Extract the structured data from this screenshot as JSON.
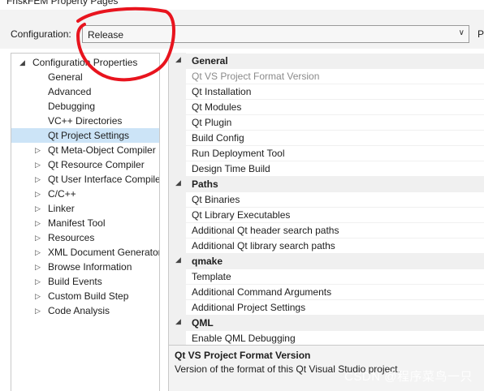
{
  "window": {
    "title": "FriskFEM Property Pages"
  },
  "config": {
    "label": "Configuration:",
    "value": "Release",
    "platform_label_partial": "P"
  },
  "tree": [
    {
      "label": "Configuration Properties",
      "level": 0,
      "expanded": true,
      "has_children": true,
      "selected": false
    },
    {
      "label": "General",
      "level": 1,
      "has_children": false,
      "selected": false
    },
    {
      "label": "Advanced",
      "level": 1,
      "has_children": false,
      "selected": false
    },
    {
      "label": "Debugging",
      "level": 1,
      "has_children": false,
      "selected": false
    },
    {
      "label": "VC++ Directories",
      "level": 1,
      "has_children": false,
      "selected": false
    },
    {
      "label": "Qt Project Settings",
      "level": 1,
      "has_children": false,
      "selected": true
    },
    {
      "label": "Qt Meta-Object Compiler",
      "level": 1,
      "has_children": true,
      "selected": false
    },
    {
      "label": "Qt Resource Compiler",
      "level": 1,
      "has_children": true,
      "selected": false
    },
    {
      "label": "Qt User Interface Compiler",
      "level": 1,
      "has_children": true,
      "selected": false
    },
    {
      "label": "C/C++",
      "level": 1,
      "has_children": true,
      "selected": false
    },
    {
      "label": "Linker",
      "level": 1,
      "has_children": true,
      "selected": false
    },
    {
      "label": "Manifest Tool",
      "level": 1,
      "has_children": true,
      "selected": false
    },
    {
      "label": "Resources",
      "level": 1,
      "has_children": true,
      "selected": false
    },
    {
      "label": "XML Document Generator",
      "level": 1,
      "has_children": true,
      "selected": false
    },
    {
      "label": "Browse Information",
      "level": 1,
      "has_children": true,
      "selected": false
    },
    {
      "label": "Build Events",
      "level": 1,
      "has_children": true,
      "selected": false
    },
    {
      "label": "Custom Build Step",
      "level": 1,
      "has_children": true,
      "selected": false
    },
    {
      "label": "Code Analysis",
      "level": 1,
      "has_children": true,
      "selected": false
    }
  ],
  "grid": [
    {
      "type": "category",
      "label": "General"
    },
    {
      "type": "prop",
      "label": "Qt VS Project Format Version",
      "disabled": true
    },
    {
      "type": "prop",
      "label": "Qt Installation"
    },
    {
      "type": "prop",
      "label": "Qt Modules"
    },
    {
      "type": "prop",
      "label": "Qt Plugin"
    },
    {
      "type": "prop",
      "label": "Build Config"
    },
    {
      "type": "prop",
      "label": "Run Deployment Tool"
    },
    {
      "type": "prop",
      "label": "Design Time Build"
    },
    {
      "type": "category",
      "label": "Paths"
    },
    {
      "type": "prop",
      "label": "Qt Binaries"
    },
    {
      "type": "prop",
      "label": "Qt Library Executables"
    },
    {
      "type": "prop",
      "label": "Additional Qt header search paths"
    },
    {
      "type": "prop",
      "label": "Additional Qt library search paths"
    },
    {
      "type": "category",
      "label": "qmake"
    },
    {
      "type": "prop",
      "label": "Template"
    },
    {
      "type": "prop",
      "label": "Additional Command Arguments"
    },
    {
      "type": "prop",
      "label": "Additional Project Settings"
    },
    {
      "type": "category",
      "label": "QML"
    },
    {
      "type": "prop",
      "label": "Enable QML Debugging"
    }
  ],
  "description": {
    "title": "Qt VS Project Format Version",
    "text": "Version of the format of this Qt Visual Studio project."
  },
  "watermark": "CSDN @程序菜鸟一只",
  "colors": {
    "selection": "#cce4f7",
    "annotation_red": "#e8141e",
    "panel_bg": "#f3f3f3"
  }
}
